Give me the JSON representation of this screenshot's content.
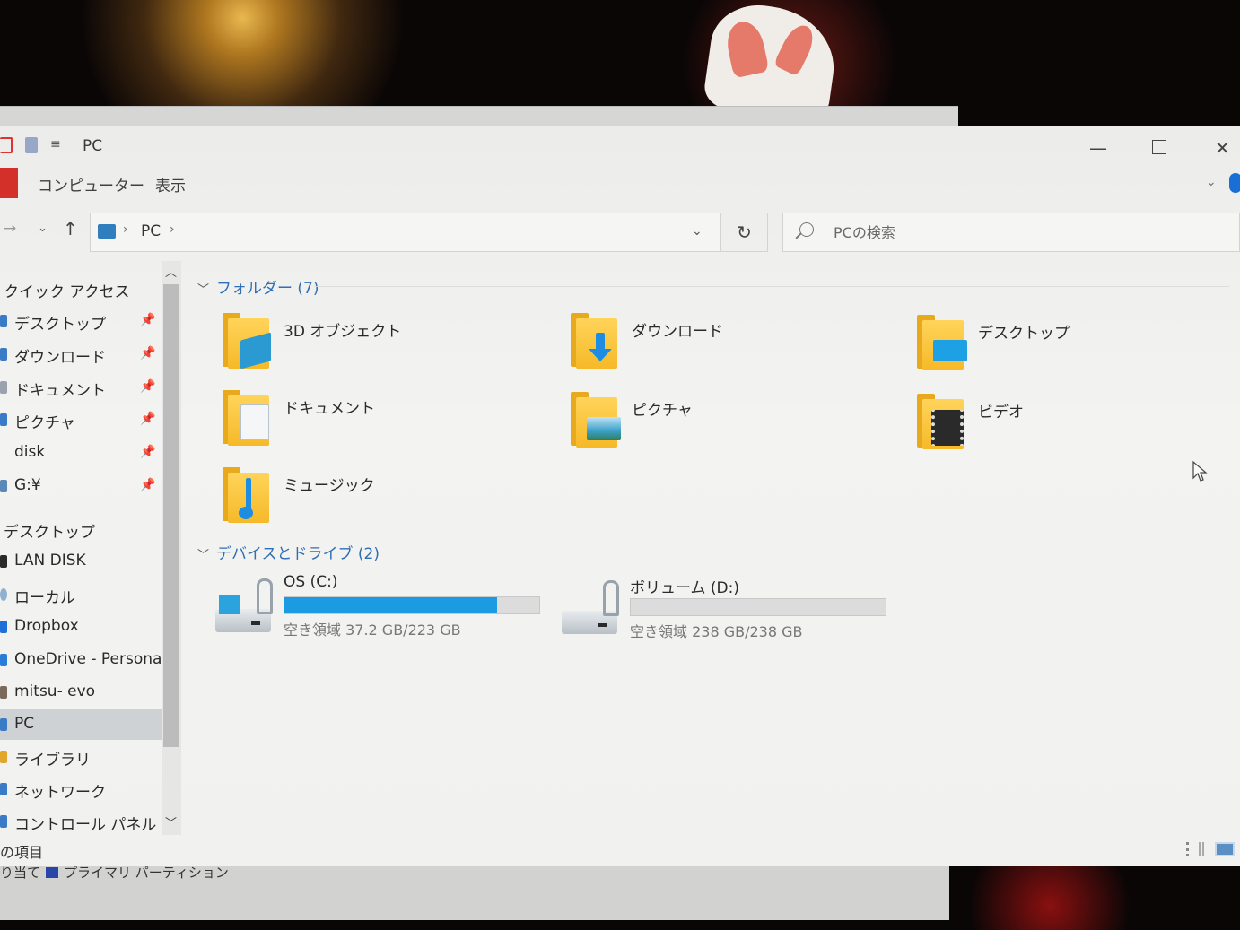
{
  "window": {
    "title": "PC",
    "ribbon_tabs": [
      "コンピューター",
      "表示"
    ]
  },
  "address": {
    "path": "PC",
    "search_placeholder": "PCの検索"
  },
  "nav": {
    "quick_access": "クイック アクセス",
    "quick_items": [
      {
        "label": "デスクトップ",
        "pinned": true
      },
      {
        "label": "ダウンロード",
        "pinned": true
      },
      {
        "label": "ドキュメント",
        "pinned": true
      },
      {
        "label": "ピクチャ",
        "pinned": true
      },
      {
        "label": "disk",
        "pinned": true
      },
      {
        "label": "G:¥",
        "pinned": true
      }
    ],
    "desktop": "デスクトップ",
    "items": [
      "LAN DISK",
      "ローカル",
      "Dropbox",
      "OneDrive - Personal",
      "mitsu- evo",
      "PC",
      "ライブラリ",
      "ネットワーク",
      "コントロール パネル"
    ],
    "selected": "PC"
  },
  "content": {
    "folders_header": "フォルダー (7)",
    "folders": [
      {
        "name": "3D オブジェクト",
        "icon": "3d-objects-icon"
      },
      {
        "name": "ダウンロード",
        "icon": "downloads-icon"
      },
      {
        "name": "デスクトップ",
        "icon": "desktop-icon"
      },
      {
        "name": "ドキュメント",
        "icon": "documents-icon"
      },
      {
        "name": "ピクチャ",
        "icon": "pictures-icon"
      },
      {
        "name": "ビデオ",
        "icon": "videos-icon"
      },
      {
        "name": "ミュージック",
        "icon": "music-icon"
      }
    ],
    "drives_header": "デバイスとドライブ (2)",
    "drives": [
      {
        "name": "OS (C:)",
        "free": "空き領域 37.2 GB/223 GB",
        "used_fraction": 0.833
      },
      {
        "name": "ボリューム (D:)",
        "free": "空き領域 238 GB/238 GB",
        "used_fraction": 0.0
      }
    ]
  },
  "status": {
    "text": "の項目"
  },
  "background_window": {
    "partition_label": "り当て",
    "partition_type": "プライマリ パーティション"
  },
  "colors": {
    "accent": "#1c9be3",
    "group_header": "#2f6fb5",
    "file_tab": "#d4302a"
  }
}
